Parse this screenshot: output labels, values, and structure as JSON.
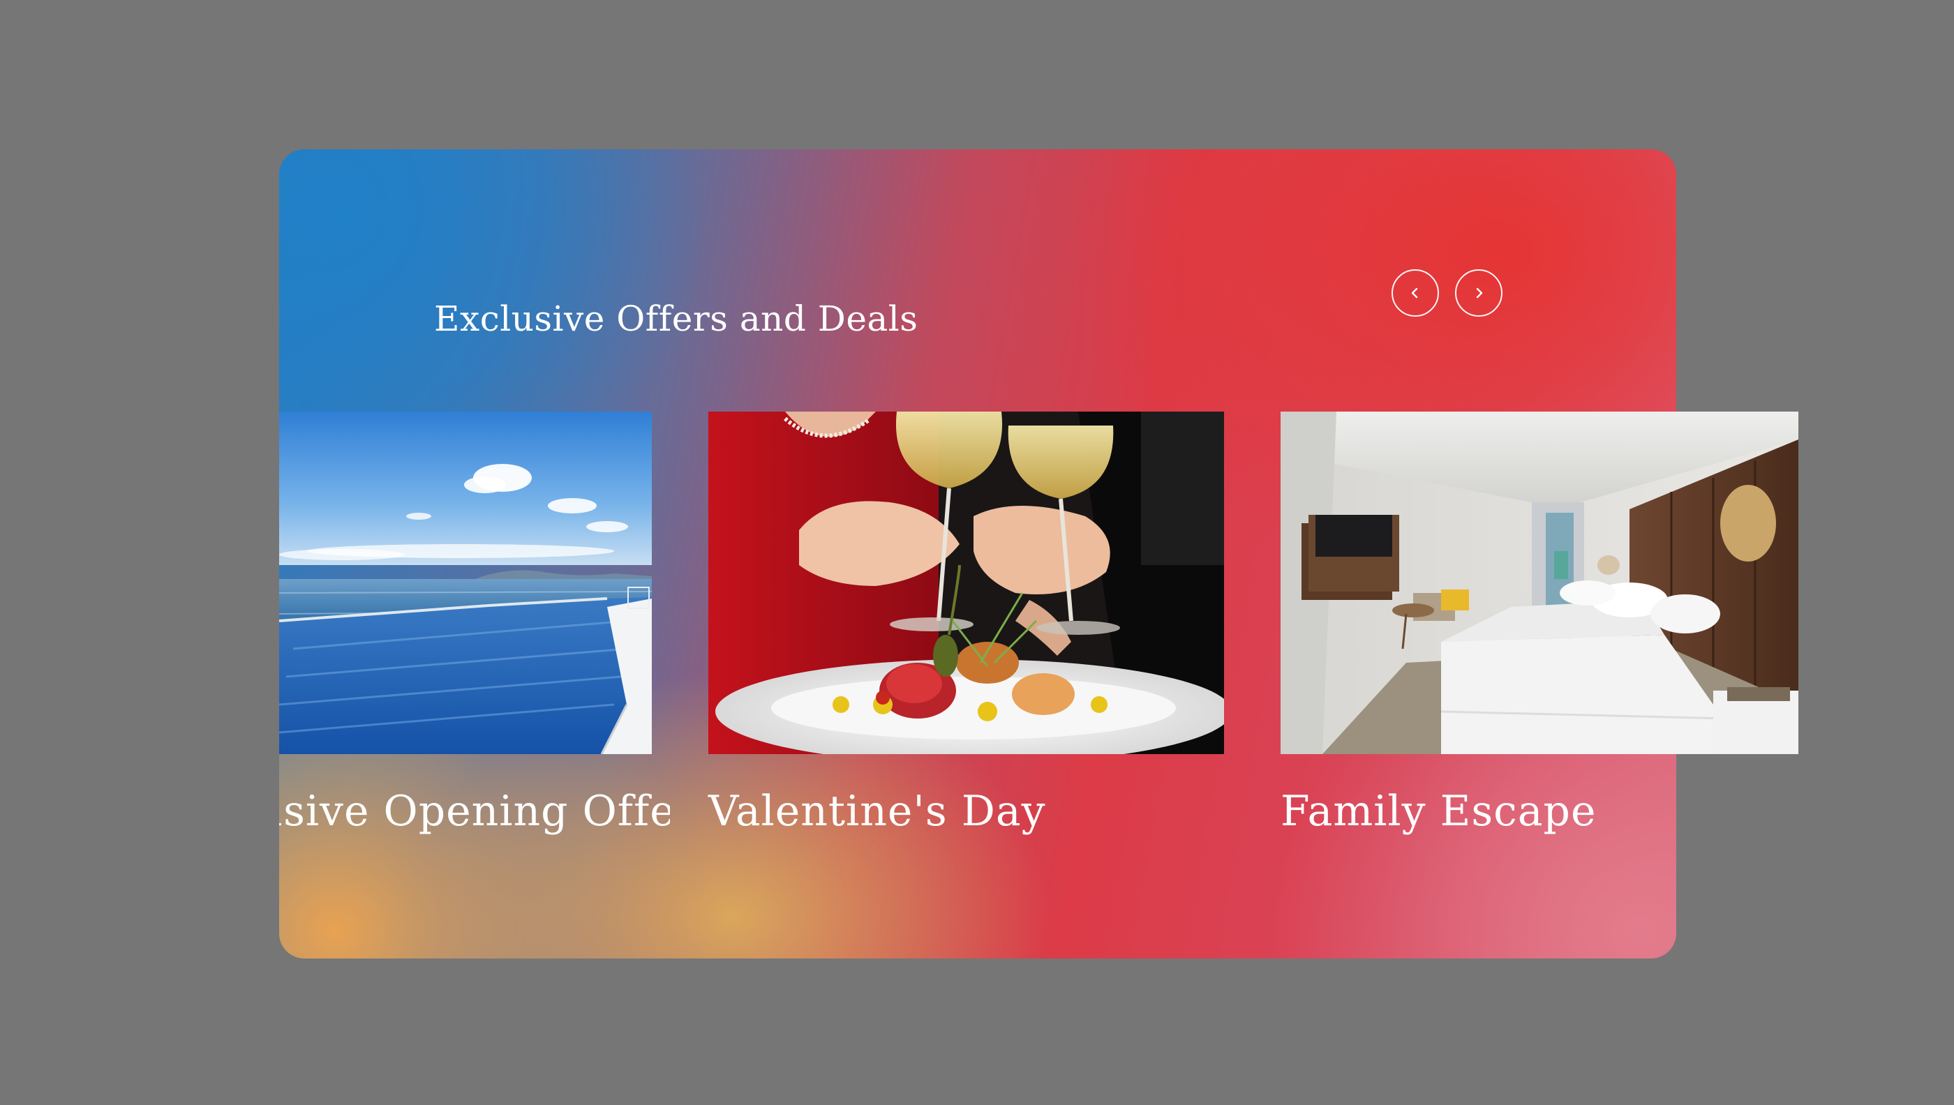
{
  "section": {
    "title": "Exclusive Offers and Deals"
  },
  "carousel": {
    "prev_icon": "chevron-left-icon",
    "next_icon": "chevron-right-icon",
    "slides": [
      {
        "title": "Exclusive Opening Offer",
        "image": "infinity-pool-sea-view"
      },
      {
        "title": "Valentine's Day",
        "image": "couple-toasting-wine-dinner"
      },
      {
        "title": "Family Escape",
        "image": "hotel-bedroom"
      }
    ]
  },
  "colors": {
    "page_background": "#767676",
    "gradient_blue": "#2080c8",
    "gradient_red": "#e63432",
    "gradient_orange": "#e8a252",
    "gradient_pink": "#e27c8c",
    "text": "#ffffff"
  }
}
